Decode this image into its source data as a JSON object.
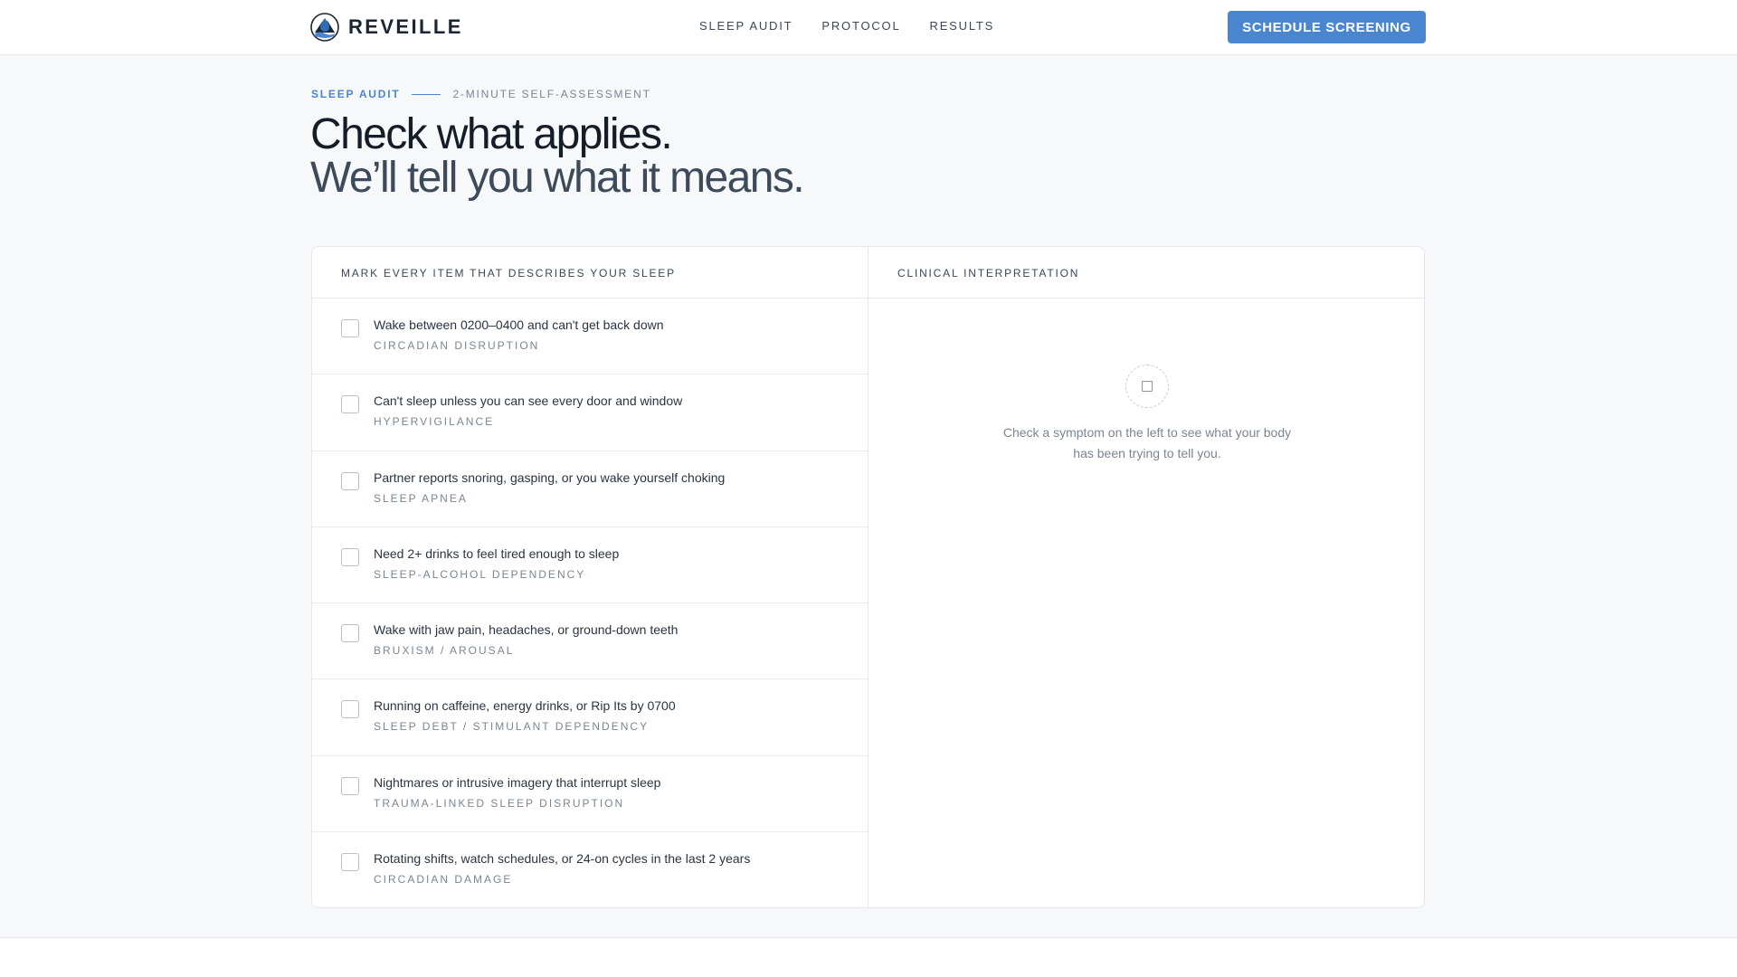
{
  "header": {
    "brand": "REVEILLE",
    "nav": [
      {
        "label": "SLEEP AUDIT"
      },
      {
        "label": "PROTOCOL"
      },
      {
        "label": "RESULTS"
      }
    ],
    "cta_label": "SCHEDULE SCREENING"
  },
  "hero": {
    "eyebrow_primary": "SLEEP AUDIT",
    "eyebrow_secondary": "2-MINUTE SELF-ASSESSMENT",
    "headline_line1": "Check what applies.",
    "headline_line2": "We’ll tell you what it means."
  },
  "checklist": {
    "heading": "MARK EVERY ITEM THAT DESCRIBES YOUR SLEEP",
    "items": [
      {
        "text": "Wake between 0200–0400 and can't get back down",
        "tag": "CIRCADIAN DISRUPTION",
        "checked": false
      },
      {
        "text": "Can't sleep unless you can see every door and window",
        "tag": "HYPERVIGILANCE",
        "checked": false
      },
      {
        "text": "Partner reports snoring, gasping, or you wake yourself choking",
        "tag": "SLEEP APNEA",
        "checked": false
      },
      {
        "text": "Need 2+ drinks to feel tired enough to sleep",
        "tag": "SLEEP-ALCOHOL DEPENDENCY",
        "checked": false
      },
      {
        "text": "Wake with jaw pain, headaches, or ground-down teeth",
        "tag": "BRUXISM / AROUSAL",
        "checked": false
      },
      {
        "text": "Running on caffeine, energy drinks, or Rip Its by 0700",
        "tag": "SLEEP DEBT / STIMULANT DEPENDENCY",
        "checked": false
      },
      {
        "text": "Nightmares or intrusive imagery that interrupt sleep",
        "tag": "TRAUMA-LINKED SLEEP DISRUPTION",
        "checked": false
      },
      {
        "text": "Rotating shifts, watch schedules, or 24-on cycles in the last 2 years",
        "tag": "CIRCADIAN DAMAGE",
        "checked": false
      }
    ]
  },
  "interpretation": {
    "heading": "CLINICAL INTERPRETATION",
    "empty_text": "Check a symptom on the left to see what your body has been trying to tell you."
  },
  "colors": {
    "accent": "#4a86cf",
    "brand_water": "#2f6db5",
    "brand_mountain": "#1b2633"
  },
  "icons": {
    "brand": "mountain-water-logo-icon",
    "empty_state": "dashed-circle-square-icon"
  }
}
